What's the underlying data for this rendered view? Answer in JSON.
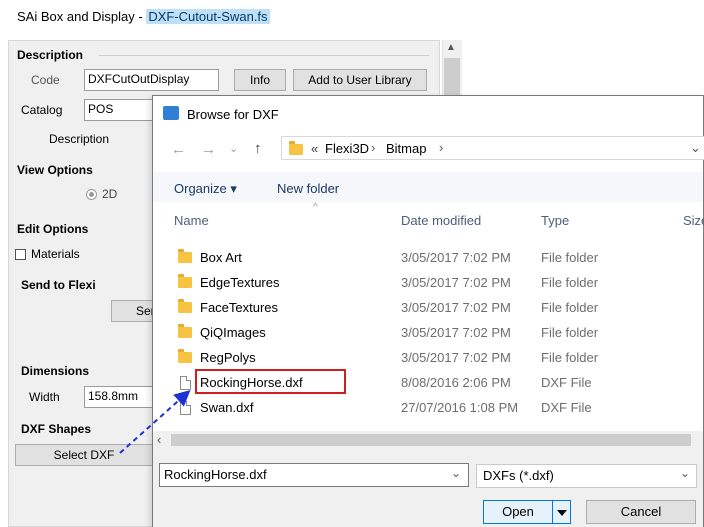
{
  "app_title": {
    "prefix": "SAi Box and Display",
    "separator": " - ",
    "filename": "DXF-Cutout-Swan.fs"
  },
  "panel": {
    "description": {
      "heading": "Description",
      "code_label": "Code",
      "code_value": "DXFCutOutDisplay",
      "info_button": "Info",
      "add_library_button": "Add to User Library",
      "catalog_label": "Catalog",
      "catalog_value": "POS",
      "description_label": "Description"
    },
    "view_options": {
      "heading": "View Options",
      "radio_2d": "2D"
    },
    "edit_options": {
      "heading": "Edit Options",
      "materials": "Materials"
    },
    "send_to_flexi": {
      "heading": "Send to Flexi",
      "send_button": "Send"
    },
    "dimensions": {
      "heading": "Dimensions",
      "width_label": "Width",
      "width_value": "158.8mm"
    },
    "dxf_shapes": {
      "heading": "DXF Shapes",
      "select_button": "Select DXF"
    }
  },
  "dialog": {
    "title": "Browse for DXF",
    "breadcrumb": {
      "overflow": "«",
      "items": [
        "Flexi3D",
        "Bitmap"
      ]
    },
    "toolbar": {
      "organize": "Organize ▾",
      "new_folder": "New folder"
    },
    "columns": {
      "name": "Name",
      "date": "Date modified",
      "type": "Type",
      "size": "Size"
    },
    "files": [
      {
        "name": "Box Art",
        "date": "3/05/2017 7:02 PM",
        "type": "File folder",
        "kind": "folder"
      },
      {
        "name": "EdgeTextures",
        "date": "3/05/2017 7:02 PM",
        "type": "File folder",
        "kind": "folder"
      },
      {
        "name": "FaceTextures",
        "date": "3/05/2017 7:02 PM",
        "type": "File folder",
        "kind": "folder"
      },
      {
        "name": "QiQImages",
        "date": "3/05/2017 7:02 PM",
        "type": "File folder",
        "kind": "folder"
      },
      {
        "name": "RegPolys",
        "date": "3/05/2017 7:02 PM",
        "type": "File folder",
        "kind": "folder"
      },
      {
        "name": "RockingHorse.dxf",
        "date": "8/08/2016 2:06 PM",
        "type": "DXF File",
        "kind": "file",
        "highlighted": true
      },
      {
        "name": "Swan.dxf",
        "date": "27/07/2016 1:08 PM",
        "type": "DXF File",
        "kind": "file"
      }
    ],
    "filename_value": "RockingHorse.dxf",
    "filetype_value": "DXFs (*.dxf)",
    "open_button": "Open",
    "cancel_button": "Cancel"
  },
  "colors": {
    "highlight_box": "#d11f1f",
    "annotation_arrow": "#1f2fd6",
    "title_highlight": "#bfe0f6"
  }
}
